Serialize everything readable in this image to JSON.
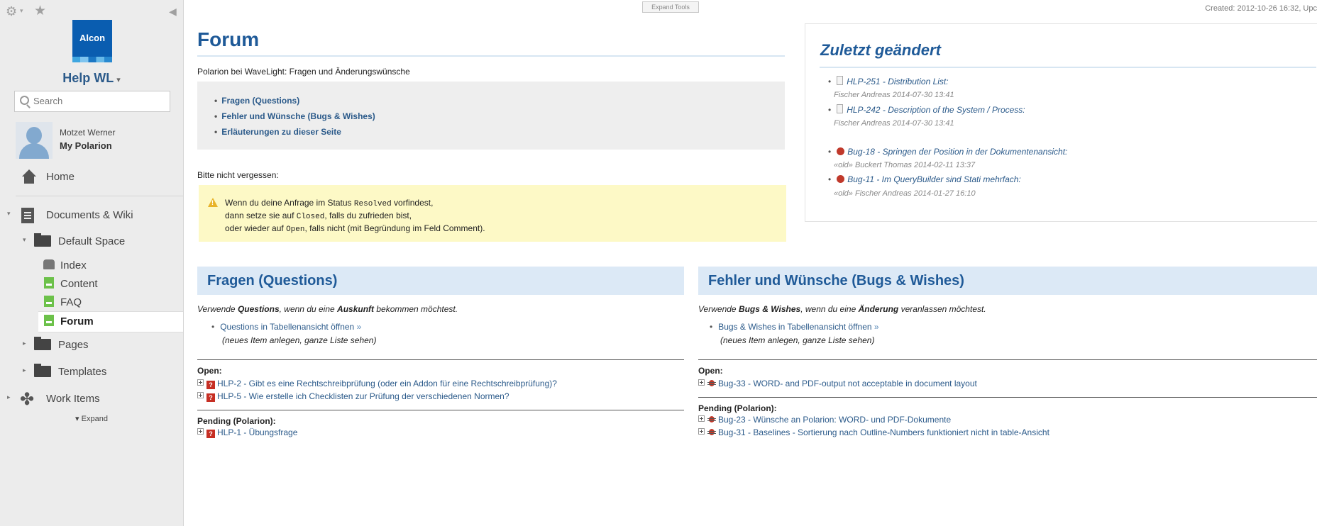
{
  "sidebar": {
    "logo_text": "Alcon",
    "project": "Help WL",
    "search_placeholder": "Search",
    "user": {
      "name": "Motzet Werner",
      "link": "My Polarion"
    },
    "home": "Home",
    "documents": "Documents & Wiki",
    "default_space": "Default Space",
    "pages": {
      "index": "Index",
      "content": "Content",
      "faq": "FAQ",
      "forum": "Forum"
    },
    "pages_folder": "Pages",
    "templates": "Templates",
    "work_items": "Work Items",
    "expand": "▾ Expand"
  },
  "topbar": {
    "expand_tools": "Expand Tools",
    "created": "Created: 2012-10-26 16:32, Upc"
  },
  "main": {
    "title": "Forum",
    "subtitle": "Polarion bei WaveLight: Fragen und Änderungswünsche",
    "toc": [
      "Fragen (Questions)",
      "Fehler und Wünsche (Bugs & Wishes)",
      "Erläuterungen zu dieser Seite"
    ],
    "reminder_label": "Bitte nicht vergessen:",
    "warning": {
      "l1a": "Wenn du deine Anfrage im Status ",
      "l1code": "Resolved",
      "l1b": " vorfindest,",
      "l2a": "dann setze sie auf ",
      "l2code": "Closed",
      "l2b": ", falls du zufrieden bist,",
      "l3a": "oder wieder auf ",
      "l3code": "Open",
      "l3b": ", falls nicht (mit Begründung im Feld Comment)."
    },
    "questions": {
      "heading": "Fragen (Questions)",
      "intro_a": "Verwende ",
      "intro_b1": "Questions",
      "intro_c": ", wenn du eine ",
      "intro_b2": "Auskunft",
      "intro_d": " bekommen möchtest.",
      "link": "Questions in Tabellenansicht öffnen",
      "raquo": "»",
      "note": "(neues Item anlegen, ganze Liste sehen)",
      "open_label": "Open:",
      "open_items": [
        "HLP-2 - Gibt es eine Rechtschreibprüfung (oder ein Addon für eine Rechtschreibprüfung)?",
        "HLP-5 - Wie erstelle ich Checklisten zur Prüfung der verschiedenen Normen?"
      ],
      "pending_label": "Pending (Polarion):",
      "pending_items": [
        "HLP-1 - Übungsfrage"
      ],
      "q_glyph": "?"
    },
    "bugs": {
      "heading": "Fehler und Wünsche (Bugs & Wishes)",
      "intro_a": "Verwende ",
      "intro_b1": "Bugs & Wishes",
      "intro_c": ", wenn du eine ",
      "intro_b2": "Änderung",
      "intro_d": " veranlassen möchtest.",
      "link": "Bugs & Wishes in Tabellenansicht öffnen",
      "raquo": "»",
      "note": "(neues Item anlegen, ganze Liste sehen)",
      "open_label": "Open:",
      "open_items": [
        "Bug-33 - WORD- and PDF-output not acceptable in document layout"
      ],
      "pending_label": "Pending (Polarion):",
      "pending_items": [
        "Bug-23 - Wünsche an Polarion: WORD- und PDF-Dokumente",
        "Bug-31 - Baselines - Sortierung nach Outline-Numbers funktioniert nicht in table-Ansicht"
      ]
    }
  },
  "recent": {
    "title": "Zuletzt geändert",
    "items": [
      {
        "text": "HLP-251 - Distribution List:",
        "meta": "Fischer Andreas 2014-07-30 13:41"
      },
      {
        "text": "HLP-242 - Description of the System / Process:",
        "meta": "Fischer Andreas 2014-07-30 13:41"
      },
      {
        "text": "Bug-18 - Springen der Position in der Dokumentenansicht:",
        "meta": "«old» Buckert Thomas 2014-02-11 13:37"
      },
      {
        "text": "Bug-11 - Im QueryBuilder sind Stati mehrfach:",
        "meta": "«old» Fischer Andreas 2014-01-27 16:10"
      }
    ]
  },
  "colors": {
    "accent": "#1f5a98",
    "link": "#2b5a8a",
    "sidebar_bg": "#ececec",
    "warning_bg": "#fdf9c6"
  }
}
